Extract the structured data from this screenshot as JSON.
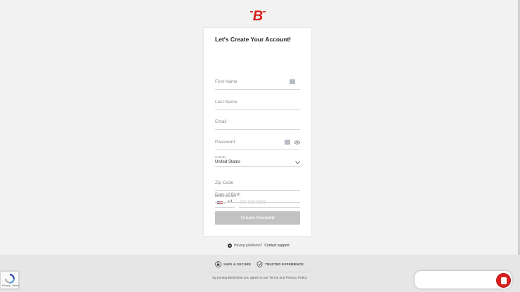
{
  "brand": {
    "logo_letter": "B",
    "accent_color": "#d9201e"
  },
  "form": {
    "title": "Let's Create Your Account!",
    "first_name_placeholder": "First Name",
    "last_name_placeholder": "Last Name",
    "email_placeholder": "Email",
    "password_placeholder": "Password",
    "country_label": "Country",
    "country_value": "United States",
    "zip_placeholder": "Zip Code",
    "phone_label": "Phone Number",
    "phone_country_flag": "us-flag-icon",
    "phone_dial_code": "+1",
    "phone_placeholder": "555-555-5555",
    "dob_placeholder": "Date of Birth",
    "submit_label": "Create Account"
  },
  "help": {
    "text": "Having problems?",
    "link": "Contact support"
  },
  "footer": {
    "badge_secure": "SAFE & SECURE",
    "badge_trusted": "TRUSTED EXPERIENCE",
    "terms_text": "By joining BetOnline you agree to our Terms and Privacy Policy."
  },
  "recaptcha": {
    "links": "Privacy - Terms"
  }
}
